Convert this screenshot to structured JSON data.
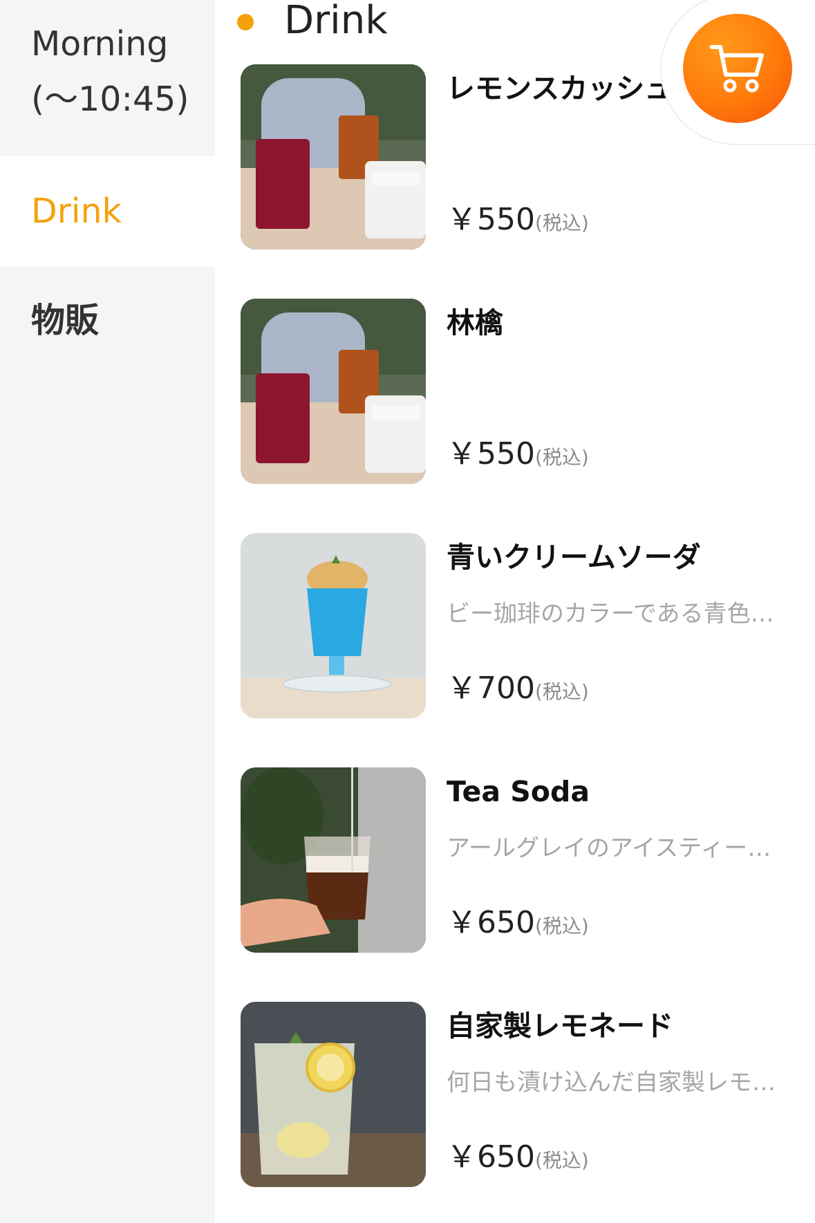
{
  "sidebar": {
    "categories": [
      {
        "label": "Morning\n(〜10:45)",
        "line1": "Morning",
        "line2": "(〜10:45)",
        "active": false
      },
      {
        "label": "Drink",
        "active": true
      },
      {
        "label": "物販",
        "active": false
      }
    ]
  },
  "section": {
    "title": "Drink"
  },
  "items": [
    {
      "name": "レモンスカッシュ",
      "desc": "",
      "price": "￥550",
      "tax": "(税込)",
      "image": "drinks-three-glasses"
    },
    {
      "name": "林檎",
      "desc": "",
      "price": "￥550",
      "tax": "(税込)",
      "image": "drinks-three-glasses"
    },
    {
      "name": "青いクリームソーダ",
      "desc": "ビー珈琲のカラーである青色…",
      "price": "￥700",
      "tax": "(税込)",
      "image": "blue-cream-soda"
    },
    {
      "name": "Tea Soda",
      "desc": "アールグレイのアイスティー…",
      "price": "￥650",
      "tax": "(税込)",
      "image": "tea-soda-glass"
    },
    {
      "name": "自家製レモネード",
      "desc": "何日も漬け込んだ自家製レモ…",
      "price": "￥650",
      "tax": "(税込)",
      "image": "lemonade-glass"
    }
  ],
  "cart": {
    "icon": "cart-icon",
    "accent": "#ff7a0b"
  },
  "colors": {
    "accent": "#f5a10c",
    "sidebar_bg": "#f5f5f5"
  }
}
